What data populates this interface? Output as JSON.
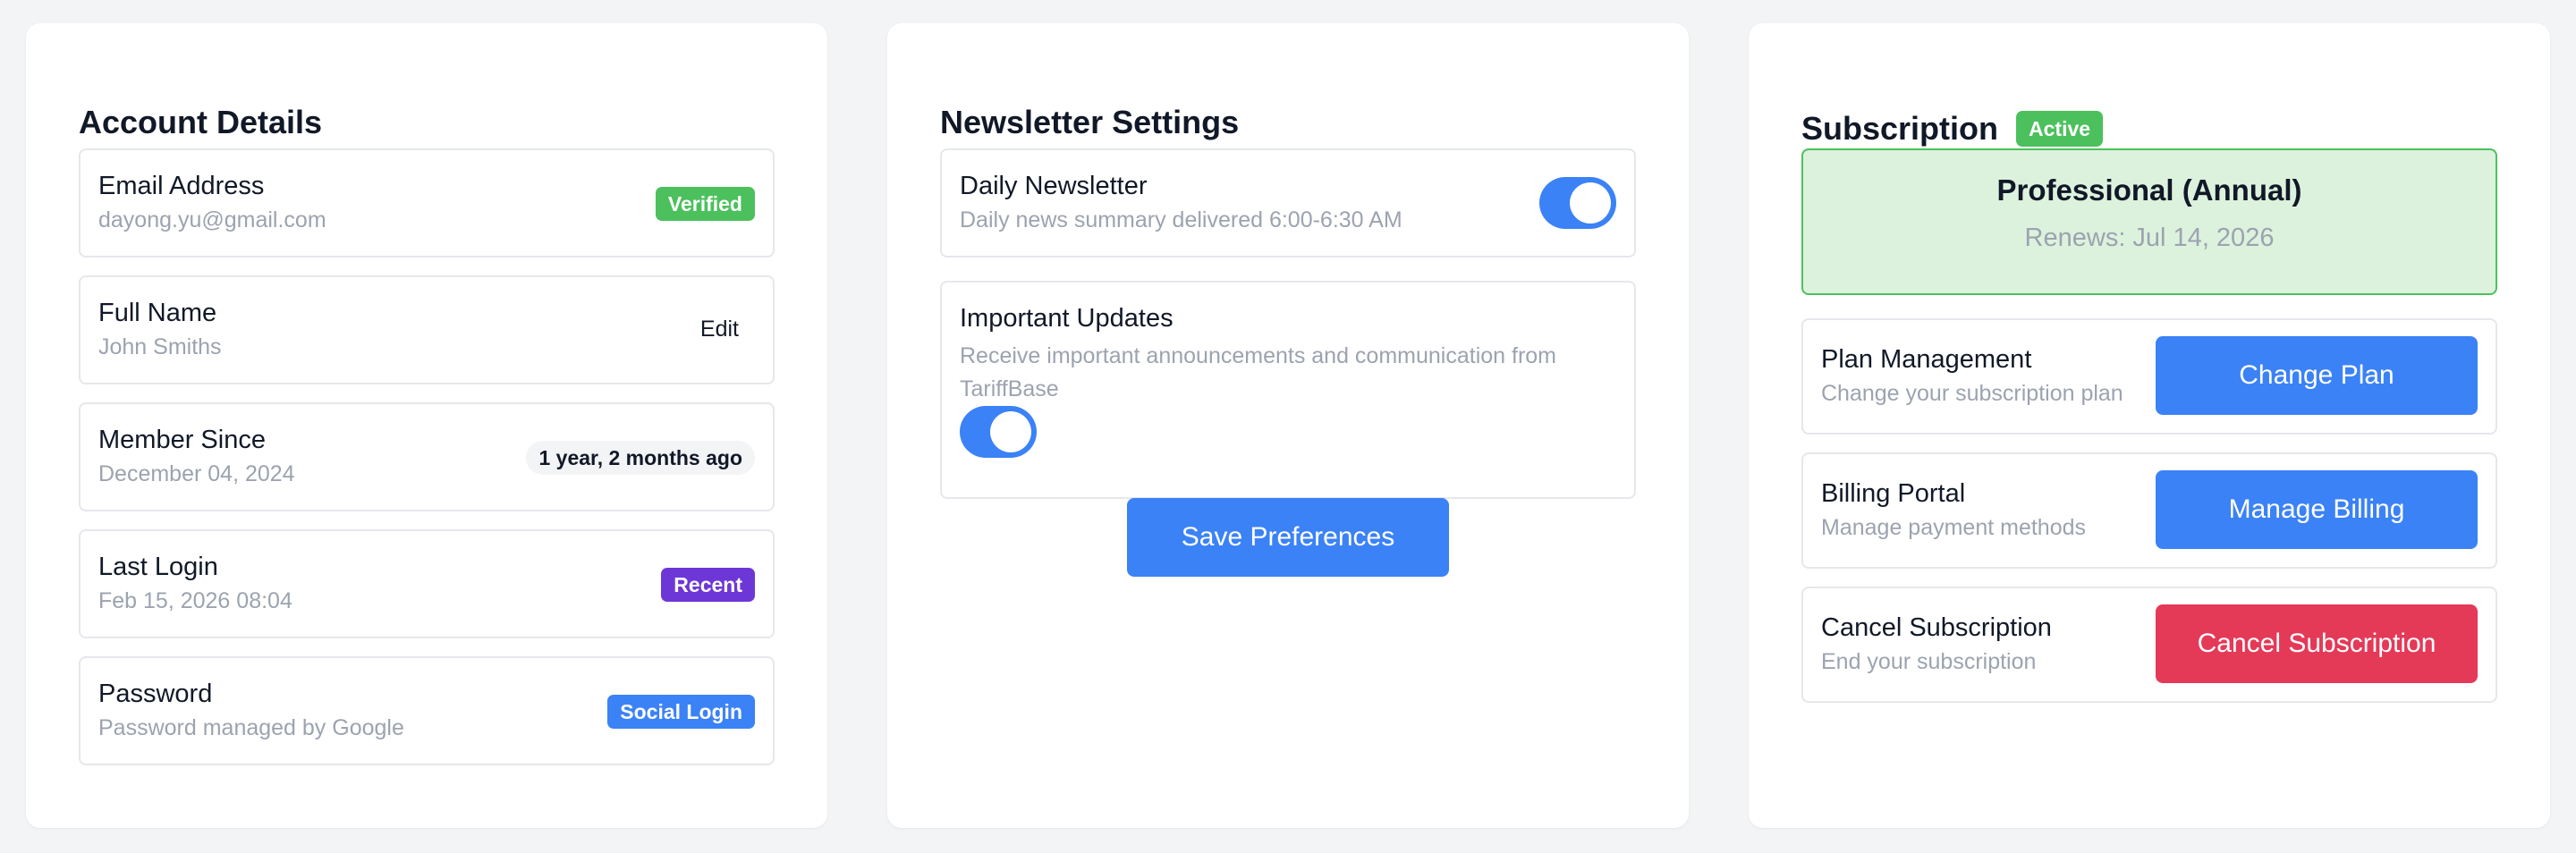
{
  "account": {
    "title": "Account Details",
    "rows": [
      {
        "label": "Email Address",
        "sub": "dayong.yu@gmail.com",
        "badge": "Verified"
      },
      {
        "label": "Full Name",
        "sub": "John Smiths",
        "action": "Edit"
      },
      {
        "label": "Member Since",
        "sub": "December 04, 2024",
        "badge": "1 year, 2 months ago"
      },
      {
        "label": "Last Login",
        "sub": "Feb 15, 2026 08:04",
        "badge": "Recent"
      },
      {
        "label": "Password",
        "sub": "Password managed by Google",
        "badge": "Social Login"
      }
    ]
  },
  "newsletter": {
    "title": "Newsletter Settings",
    "items": [
      {
        "label": "Daily Newsletter",
        "sub": "Daily news summary delivered 6:00-6:30 AM",
        "enabled": true
      },
      {
        "label": "Important Updates",
        "sub": "Receive important announcements and communication from TariffBase",
        "enabled": true
      }
    ],
    "save_label": "Save Preferences"
  },
  "subscription": {
    "title": "Subscription",
    "status": "Active",
    "plan_name": "Professional (Annual)",
    "renews": "Renews: Jul 14, 2026",
    "rows": [
      {
        "label": "Plan Management",
        "sub": "Change your subscription plan",
        "button": "Change Plan"
      },
      {
        "label": "Billing Portal",
        "sub": "Manage payment methods",
        "button": "Manage Billing"
      },
      {
        "label": "Cancel Subscription",
        "sub": "End your subscription",
        "button": "Cancel Subscription"
      }
    ]
  },
  "colors": {
    "accent": "#3b82f6",
    "success": "#4cc05d",
    "purple": "#6d37d7",
    "danger": "#e53958"
  }
}
